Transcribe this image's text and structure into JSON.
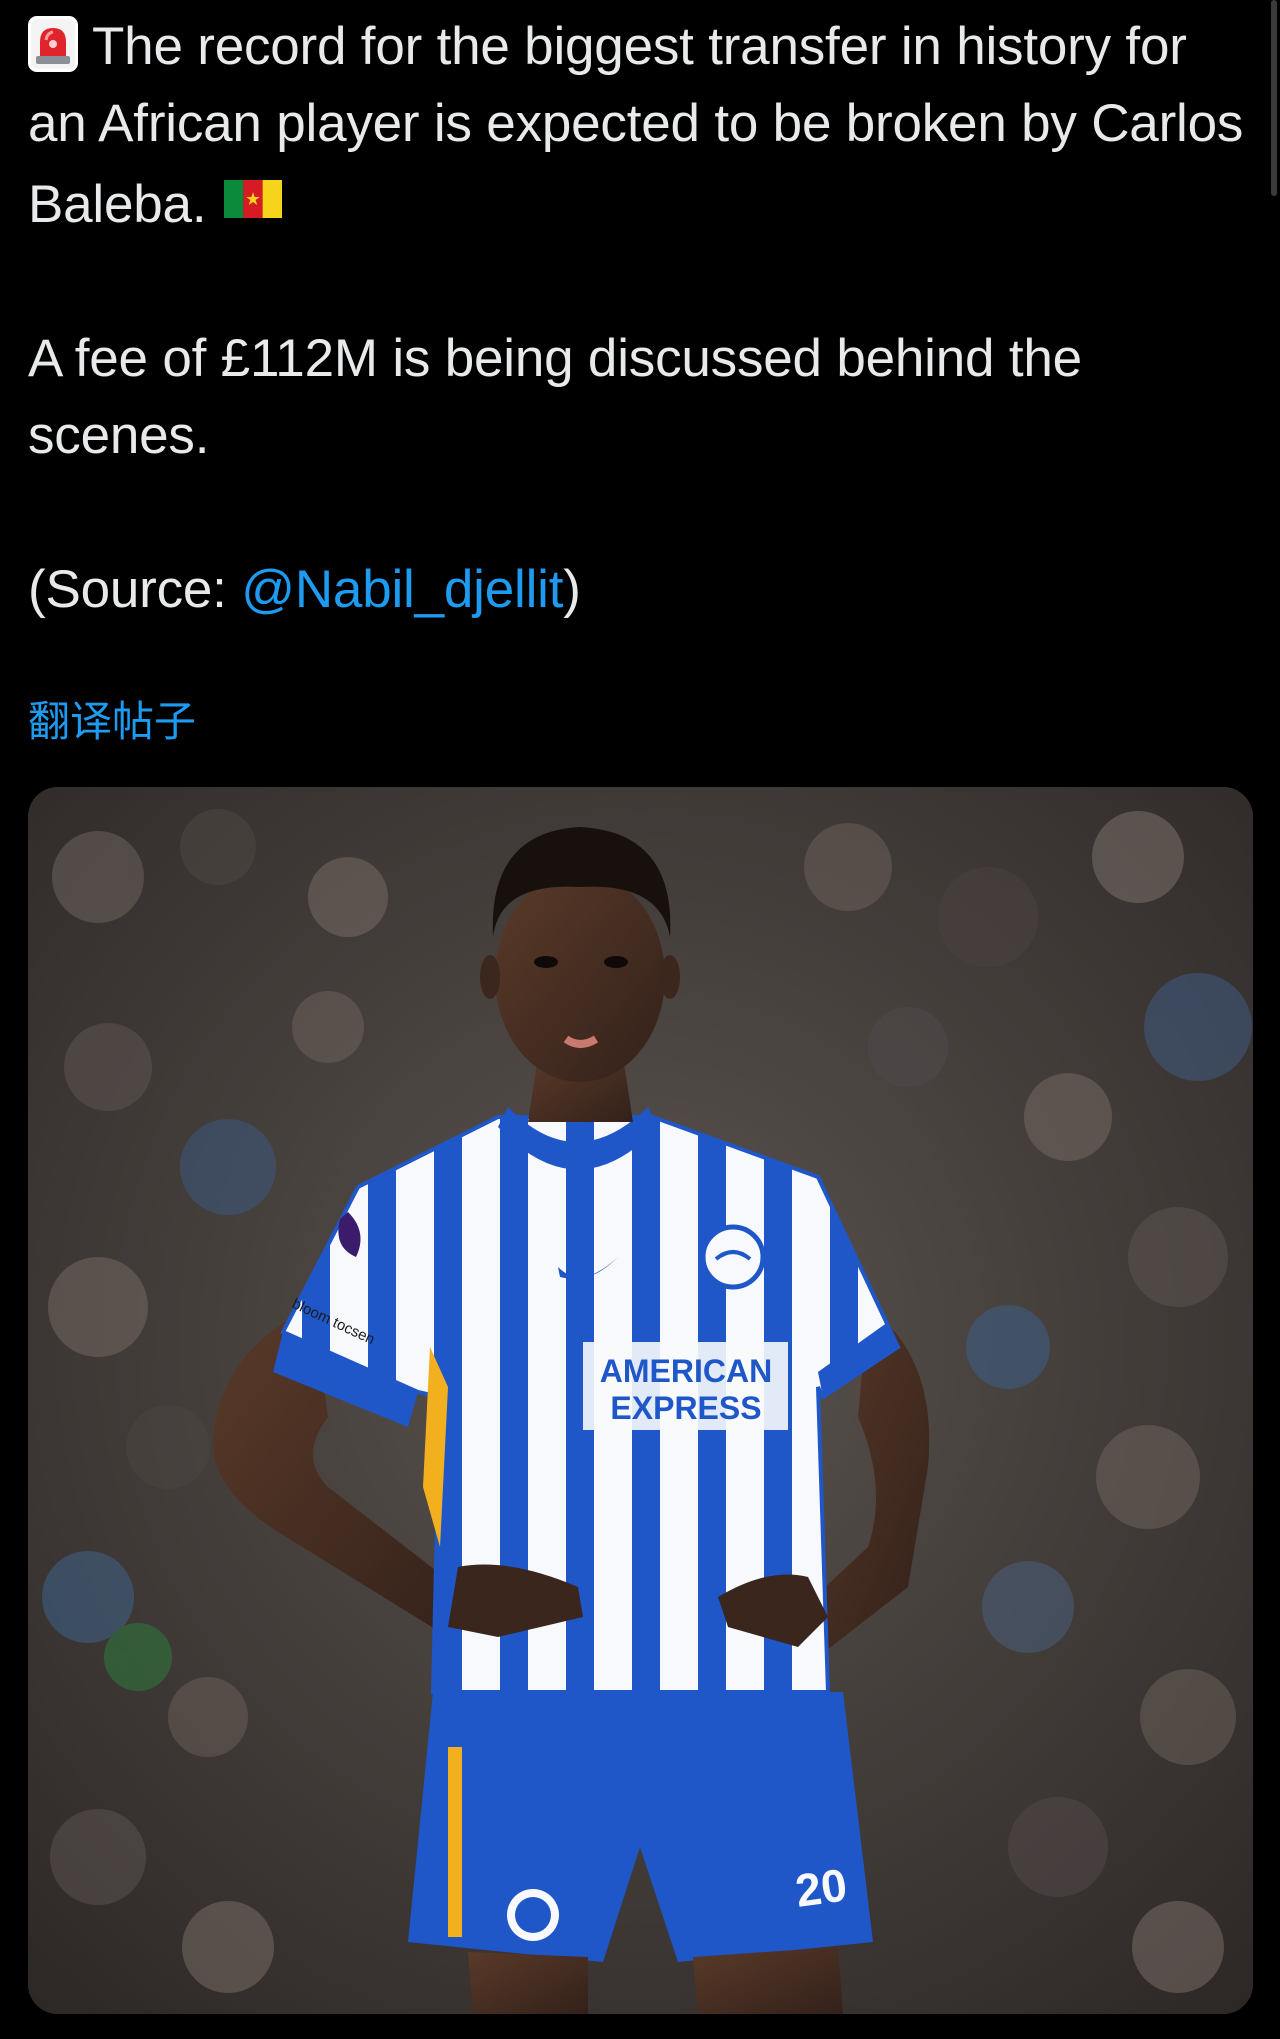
{
  "tweet": {
    "line1": "The record for the biggest transfer in history for an African player is expected to be broken by Carlos Baleba.",
    "line2": "A fee of £112M is being discussed behind the scenes.",
    "source_prefix": "(Source: ",
    "source_handle": "@Nabil_djellit",
    "source_suffix": ")",
    "siren_icon": "rotating-light-emoji",
    "flag_icon": "cameroon-flag-emoji"
  },
  "translate_label": "翻译帖子",
  "media": {
    "sponsor_line1": "AMERICAN",
    "sponsor_line2": "EXPRESS",
    "shirt_number": "20",
    "sleeve_badge": "bloom tocsen"
  },
  "colors": {
    "background": "#000000",
    "text": "#e7e9ea",
    "link": "#1d9bf0"
  }
}
